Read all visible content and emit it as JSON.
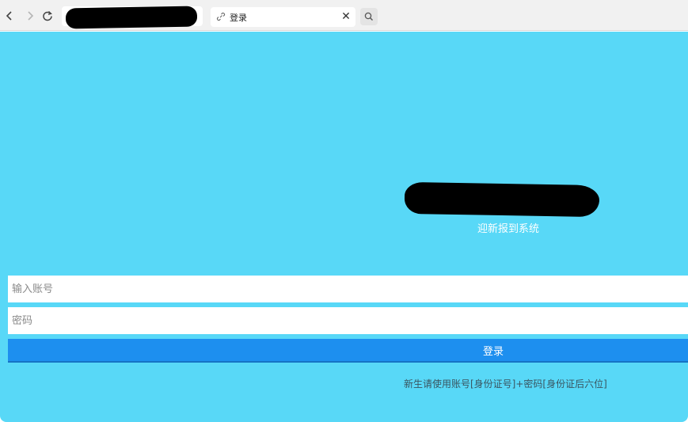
{
  "browser": {
    "back_icon": "‹",
    "forward_icon": "›",
    "reload_icon": "↻",
    "tab": {
      "title": "登录",
      "close_icon": "✕"
    }
  },
  "login": {
    "subtitle": "迎新报到系统",
    "account_placeholder": "输入账号",
    "password_placeholder": "密码",
    "login_label": "登录",
    "hint": "新生请使用账号[身份证号]+密码[身份证后六位]"
  },
  "colors": {
    "page_background": "#58d8f7",
    "login_button": "#1d8fef"
  }
}
